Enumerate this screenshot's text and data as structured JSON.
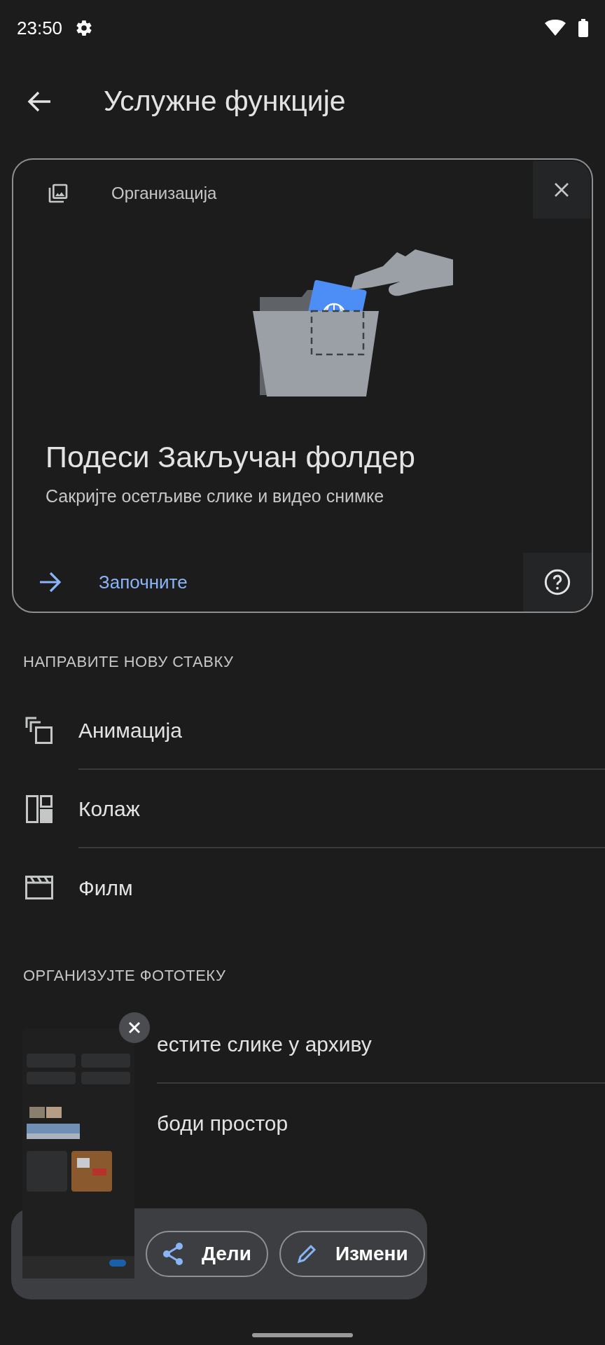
{
  "status_bar": {
    "time": "23:50"
  },
  "app_bar": {
    "title": "Услужне функције"
  },
  "promo_card": {
    "category": "Организација",
    "title": "Подеси Закључан фолдер",
    "description": "Сакријте осетљиве слике и видео снимке",
    "action": "Започните"
  },
  "sections": [
    {
      "heading": "НАПРАВИТЕ НОВУ СТАВКУ",
      "items": [
        {
          "kind": "animation",
          "label": "Анимација"
        },
        {
          "kind": "collage",
          "label": "Колаж"
        },
        {
          "kind": "movie",
          "label": "Филм"
        }
      ]
    },
    {
      "heading": "ОРГАНИЗУЈТЕ ФОТОТЕКУ",
      "items": [
        {
          "kind": "covered",
          "label": "естите слике у архиву"
        },
        {
          "kind": "covered",
          "label": "боди простор"
        }
      ]
    }
  ],
  "screenshot_preview": {
    "actions": [
      {
        "kind": "share",
        "label": "Дели"
      },
      {
        "kind": "edit",
        "label": "Измени"
      }
    ]
  }
}
